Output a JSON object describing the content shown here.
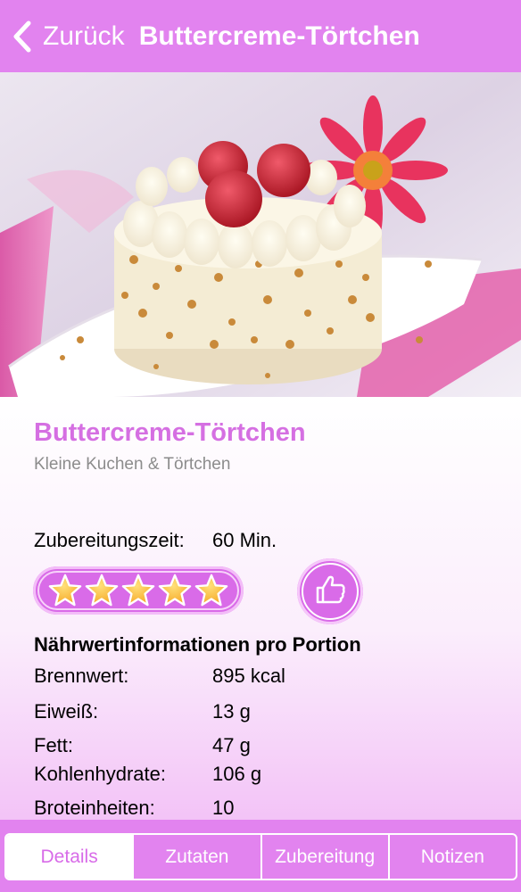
{
  "navbar": {
    "back_label": "Zurück",
    "title": "Buttercreme-Törtchen"
  },
  "recipe": {
    "title": "Buttercreme-Törtchen",
    "category": "Kleine Kuchen & Törtchen",
    "prep_label": "Zubereitungszeit:",
    "prep_value": "60 Min.",
    "rating": 5,
    "rating_max": 5
  },
  "nutrition": {
    "heading": "Nährwertinformationen pro Portion",
    "rows": [
      {
        "label": "Brennwert:",
        "value": "895 kcal"
      },
      {
        "label": "Eiweiß:",
        "value": "13 g"
      },
      {
        "label": "Fett:",
        "value": "47 g"
      },
      {
        "label": "Kohlenhydrate:",
        "value": "106 g"
      },
      {
        "label": "Broteinheiten:",
        "value": "10"
      }
    ]
  },
  "tabs": [
    {
      "label": "Details",
      "active": true
    },
    {
      "label": "Zutaten",
      "active": false
    },
    {
      "label": "Zubereitung",
      "active": false
    },
    {
      "label": "Notizen",
      "active": false
    }
  ],
  "icons": {
    "back": "chevron-left-icon",
    "star": "star-icon",
    "like": "thumbs-up-icon"
  },
  "colors": {
    "accent": "#e283ef",
    "title_pink": "#d56fe2",
    "star_gold": "#f6a623"
  }
}
